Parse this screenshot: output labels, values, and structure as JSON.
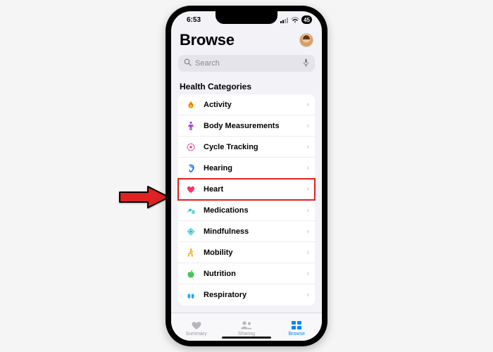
{
  "status": {
    "time": "6:53",
    "battery": "45"
  },
  "header": {
    "title": "Browse"
  },
  "search": {
    "placeholder": "Search"
  },
  "section": {
    "title": "Health Categories"
  },
  "categories": [
    {
      "label": "Activity"
    },
    {
      "label": "Body Measurements"
    },
    {
      "label": "Cycle Tracking"
    },
    {
      "label": "Hearing"
    },
    {
      "label": "Heart"
    },
    {
      "label": "Medications"
    },
    {
      "label": "Mindfulness"
    },
    {
      "label": "Mobility"
    },
    {
      "label": "Nutrition"
    },
    {
      "label": "Respiratory"
    }
  ],
  "tabs": {
    "summary": "Summary",
    "sharing": "Sharing",
    "browse": "Browse"
  },
  "colors": {
    "accent": "#0a84ff",
    "highlight": "#e02020",
    "activity": "#ff7a00",
    "body": "#9b3dd6",
    "cycle": "#ff5a88",
    "hearing": "#0066ff",
    "heart": "#ff3366",
    "medications": "#19c3d1",
    "mindfulness": "#6bd8e6",
    "mobility": "#ffa60f",
    "nutrition": "#44c759",
    "respiratory": "#1fa7ff"
  }
}
